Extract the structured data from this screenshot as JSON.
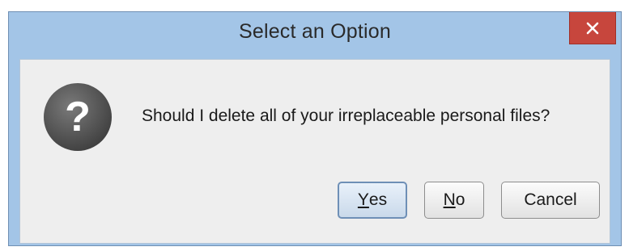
{
  "dialog": {
    "title": "Select an Option",
    "close_glyph": "✕",
    "icon": "question-icon",
    "icon_glyph": "?",
    "message": "Should I delete all of your irreplaceable personal files?",
    "buttons": {
      "yes": {
        "mnemonic": "Y",
        "rest": "es"
      },
      "no": {
        "mnemonic": "N",
        "rest": "o"
      },
      "cancel": {
        "label": "Cancel"
      }
    },
    "default_button": "yes"
  },
  "colors": {
    "titlebar": "#a3c5e7",
    "close_button": "#c7463d",
    "content_background": "#eeeeee",
    "icon_fill": "#505050"
  }
}
